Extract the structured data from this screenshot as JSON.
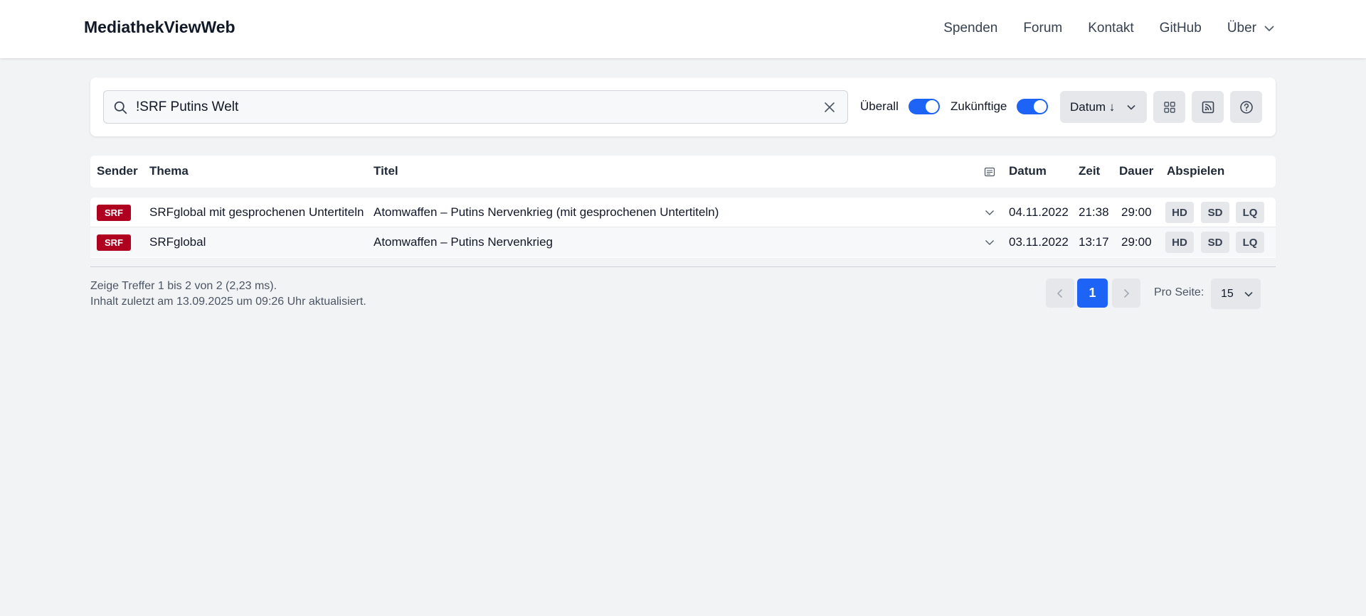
{
  "brand": "MediathekViewWeb",
  "nav": {
    "items": [
      "Spenden",
      "Forum",
      "Kontakt",
      "GitHub"
    ],
    "about": "Über"
  },
  "search": {
    "value": "!SRF Putins Welt",
    "placeholder": ""
  },
  "toggles": {
    "everywhere_label": "Überall",
    "everywhere_on": true,
    "future_label": "Zukünftige",
    "future_on": true
  },
  "sort": {
    "label": "Datum ↓"
  },
  "toolbar_icons": [
    "grid-icon",
    "rss-icon",
    "help-icon"
  ],
  "table": {
    "headers": {
      "sender": "Sender",
      "thema": "Thema",
      "titel": "Titel",
      "datum": "Datum",
      "zeit": "Zeit",
      "dauer": "Dauer",
      "abspielen": "Abspielen"
    },
    "rows": [
      {
        "sender": "SRF",
        "thema": "SRFglobal mit gesprochenen Untertiteln",
        "titel": "Atomwaffen – Putins Nervenkrieg (mit gesprochenen Untertiteln)",
        "datum": "04.11.2022",
        "zeit": "21:38",
        "dauer": "29:00",
        "qualities": [
          "HD",
          "SD",
          "LQ"
        ]
      },
      {
        "sender": "SRF",
        "thema": "SRFglobal",
        "titel": "Atomwaffen – Putins Nervenkrieg",
        "datum": "03.11.2022",
        "zeit": "13:17",
        "dauer": "29:00",
        "qualities": [
          "HD",
          "SD",
          "LQ"
        ]
      }
    ]
  },
  "footer": {
    "hits": "Zeige Treffer 1 bis 2 von 2 (2,23 ms).",
    "updated": "Inhalt zuletzt am 13.09.2025 um 09:26 Uhr aktualisiert."
  },
  "pagination": {
    "current_page": "1",
    "per_page_label": "Pro Seite:",
    "per_page_value": "15"
  },
  "colors": {
    "accent": "#1d63f5",
    "srf_badge": "#b00020",
    "background": "#f2f3f5"
  }
}
